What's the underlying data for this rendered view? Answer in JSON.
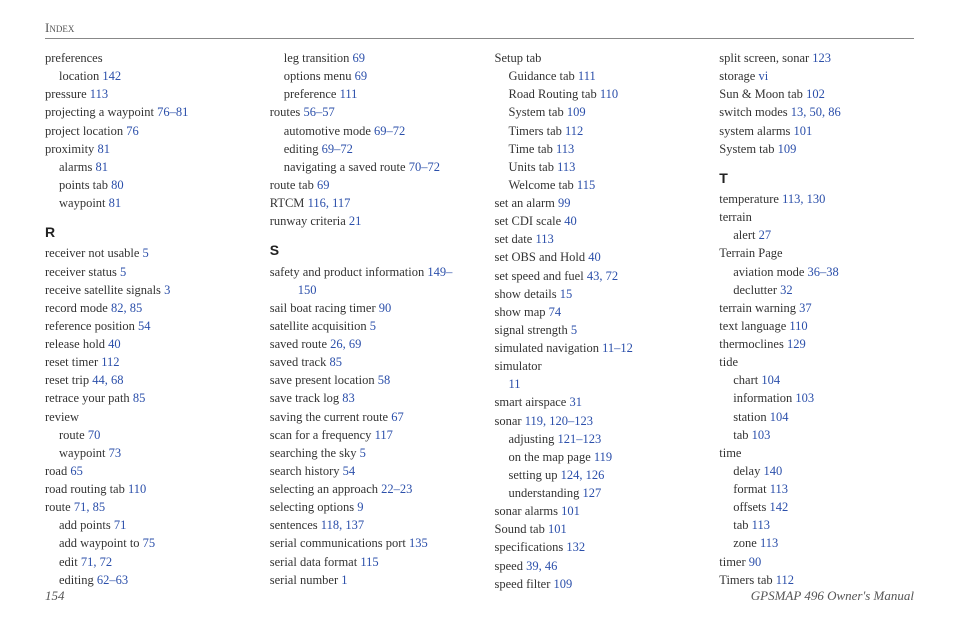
{
  "header": "Index",
  "footer": {
    "page_number": "154",
    "manual": "GPSMAP 496 Owner's Manual"
  },
  "columns": [
    [
      {
        "text": "preferences",
        "pages": ""
      },
      {
        "text": "location",
        "pages": "142",
        "indent": 1
      },
      {
        "text": "pressure",
        "pages": "113"
      },
      {
        "text": "projecting a waypoint",
        "pages": "76–81"
      },
      {
        "text": "project location",
        "pages": "76"
      },
      {
        "text": "proximity",
        "pages": "81"
      },
      {
        "text": "alarms",
        "pages": "81",
        "indent": 1
      },
      {
        "text": "points tab",
        "pages": "80",
        "indent": 1
      },
      {
        "text": "waypoint",
        "pages": "81",
        "indent": 1
      },
      {
        "heading": "R"
      },
      {
        "text": "receiver not usable",
        "pages": "5"
      },
      {
        "text": "receiver status",
        "pages": "5"
      },
      {
        "text": "receive satellite signals",
        "pages": "3"
      },
      {
        "text": "record mode",
        "pages": "82, 85"
      },
      {
        "text": "reference position",
        "pages": "54"
      },
      {
        "text": "release hold",
        "pages": "40"
      },
      {
        "text": "reset timer",
        "pages": "112"
      },
      {
        "text": "reset trip",
        "pages": "44, 68"
      },
      {
        "text": "retrace your path",
        "pages": "85"
      },
      {
        "text": "review",
        "pages": ""
      },
      {
        "text": "route",
        "pages": "70",
        "indent": 1
      },
      {
        "text": "waypoint",
        "pages": "73",
        "indent": 1
      },
      {
        "text": "road",
        "pages": "65"
      },
      {
        "text": "road routing tab",
        "pages": "110"
      },
      {
        "text": "route",
        "pages": "71, 85"
      },
      {
        "text": "add points",
        "pages": "71",
        "indent": 1
      },
      {
        "text": "add waypoint to",
        "pages": "75",
        "indent": 1
      },
      {
        "text": "edit",
        "pages": "71, 72",
        "indent": 1
      },
      {
        "text": "editing",
        "pages": "62–63",
        "indent": 1
      }
    ],
    [
      {
        "text": "leg transition",
        "pages": "69",
        "indent": 1
      },
      {
        "text": "options menu",
        "pages": "69",
        "indent": 1
      },
      {
        "text": "preference",
        "pages": "111",
        "indent": 1
      },
      {
        "text": "routes",
        "pages": "56–57"
      },
      {
        "text": "automotive mode",
        "pages": "69–72",
        "indent": 1
      },
      {
        "text": "editing",
        "pages": "69–72",
        "indent": 1
      },
      {
        "text": "navigating a saved route",
        "pages": "70–72",
        "indent": 1
      },
      {
        "text": "route tab",
        "pages": "69"
      },
      {
        "text": "RTCM",
        "pages": "116, 117"
      },
      {
        "text": "runway criteria",
        "pages": "21"
      },
      {
        "heading": "S"
      },
      {
        "text": "safety and product information",
        "pages": "149–"
      },
      {
        "text": "150",
        "pages": "",
        "indent": 2,
        "pgonly": true
      },
      {
        "text": "sail boat racing timer",
        "pages": "90"
      },
      {
        "text": "satellite acquisition",
        "pages": "5"
      },
      {
        "text": "saved route",
        "pages": "26, 69"
      },
      {
        "text": "saved track",
        "pages": "85"
      },
      {
        "text": "save present location",
        "pages": "58"
      },
      {
        "text": "save track log",
        "pages": "83"
      },
      {
        "text": "saving the current route",
        "pages": "67"
      },
      {
        "text": "scan for a frequency",
        "pages": "117"
      },
      {
        "text": "searching the sky",
        "pages": "5"
      },
      {
        "text": "search history",
        "pages": "54"
      },
      {
        "text": "selecting an approach",
        "pages": "22–23"
      },
      {
        "text": "selecting options",
        "pages": "9"
      },
      {
        "text": "sentences",
        "pages": "118, 137"
      },
      {
        "text": "serial communications port",
        "pages": "135"
      },
      {
        "text": "serial data format",
        "pages": "115"
      },
      {
        "text": "serial number",
        "pages": "1"
      }
    ],
    [
      {
        "text": "Setup tab",
        "pages": ""
      },
      {
        "text": "Guidance tab",
        "pages": "111",
        "indent": 1
      },
      {
        "text": "Road Routing tab",
        "pages": "110",
        "indent": 1
      },
      {
        "text": "System tab",
        "pages": "109",
        "indent": 1
      },
      {
        "text": "Timers tab",
        "pages": "112",
        "indent": 1
      },
      {
        "text": "Time tab",
        "pages": "113",
        "indent": 1
      },
      {
        "text": "Units tab",
        "pages": "113",
        "indent": 1
      },
      {
        "text": "Welcome tab",
        "pages": "115",
        "indent": 1
      },
      {
        "text": "set an alarm",
        "pages": "99"
      },
      {
        "text": "set CDI scale",
        "pages": "40"
      },
      {
        "text": "set date",
        "pages": "113"
      },
      {
        "text": "set OBS and Hold",
        "pages": "40"
      },
      {
        "text": "set speed and fuel",
        "pages": "43, 72"
      },
      {
        "text": "show details",
        "pages": "15"
      },
      {
        "text": "show map",
        "pages": "74"
      },
      {
        "text": "signal strength",
        "pages": "5"
      },
      {
        "text": "simulated navigation",
        "pages": "11–12"
      },
      {
        "text": "simulator",
        "pages": ""
      },
      {
        "text": "11",
        "pages": "",
        "indent": 1,
        "pgonly": true
      },
      {
        "text": "smart airspace",
        "pages": "31"
      },
      {
        "text": "sonar",
        "pages": "119, 120–123"
      },
      {
        "text": "adjusting",
        "pages": "121–123",
        "indent": 1
      },
      {
        "text": "on the map page",
        "pages": "119",
        "indent": 1
      },
      {
        "text": "setting up",
        "pages": "124, 126",
        "indent": 1
      },
      {
        "text": "understanding",
        "pages": "127",
        "indent": 1
      },
      {
        "text": "sonar alarms",
        "pages": "101"
      },
      {
        "text": "Sound tab",
        "pages": "101"
      },
      {
        "text": "specifications",
        "pages": "132"
      },
      {
        "text": "speed",
        "pages": "39, 46"
      },
      {
        "text": "speed filter",
        "pages": "109"
      }
    ],
    [
      {
        "text": "split screen, sonar",
        "pages": "123"
      },
      {
        "text": "storage",
        "pages": "vi"
      },
      {
        "text": "Sun & Moon tab",
        "pages": "102"
      },
      {
        "text": "switch modes",
        "pages": "13, 50, 86"
      },
      {
        "text": "system alarms",
        "pages": "101"
      },
      {
        "text": "System tab",
        "pages": "109"
      },
      {
        "heading": "T"
      },
      {
        "text": "temperature",
        "pages": "113, 130"
      },
      {
        "text": "terrain",
        "pages": ""
      },
      {
        "text": "alert",
        "pages": "27",
        "indent": 1
      },
      {
        "text": "Terrain Page",
        "pages": ""
      },
      {
        "text": "aviation mode",
        "pages": "36–38",
        "indent": 1
      },
      {
        "text": "declutter",
        "pages": "32",
        "indent": 1
      },
      {
        "text": "terrain warning",
        "pages": "37"
      },
      {
        "text": "text language",
        "pages": "110"
      },
      {
        "text": "thermoclines",
        "pages": "129"
      },
      {
        "text": "tide",
        "pages": ""
      },
      {
        "text": "chart",
        "pages": "104",
        "indent": 1
      },
      {
        "text": "information",
        "pages": "103",
        "indent": 1
      },
      {
        "text": "station",
        "pages": "104",
        "indent": 1
      },
      {
        "text": "tab",
        "pages": "103",
        "indent": 1
      },
      {
        "text": "time",
        "pages": ""
      },
      {
        "text": "delay",
        "pages": "140",
        "indent": 1
      },
      {
        "text": "format",
        "pages": "113",
        "indent": 1
      },
      {
        "text": "offsets",
        "pages": "142",
        "indent": 1
      },
      {
        "text": "tab",
        "pages": "113",
        "indent": 1
      },
      {
        "text": "zone",
        "pages": "113",
        "indent": 1
      },
      {
        "text": "timer",
        "pages": "90"
      },
      {
        "text": "Timers tab",
        "pages": "112"
      }
    ]
  ]
}
